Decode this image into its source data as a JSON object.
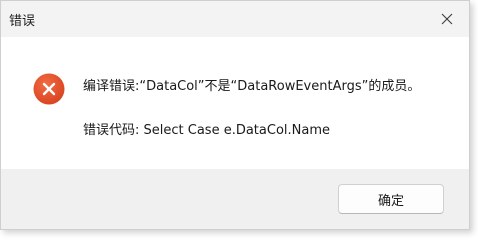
{
  "window": {
    "title": "错误",
    "close_icon": "close-icon"
  },
  "message": {
    "icon": "error-icon",
    "icon_color": "#e5532d",
    "main_text": "编译错误:“DataCol”不是“DataRowEventArgs”的成员。",
    "code_text": "错误代码:  Select Case e.DataCol.Name"
  },
  "footer": {
    "ok_label": "确定"
  }
}
